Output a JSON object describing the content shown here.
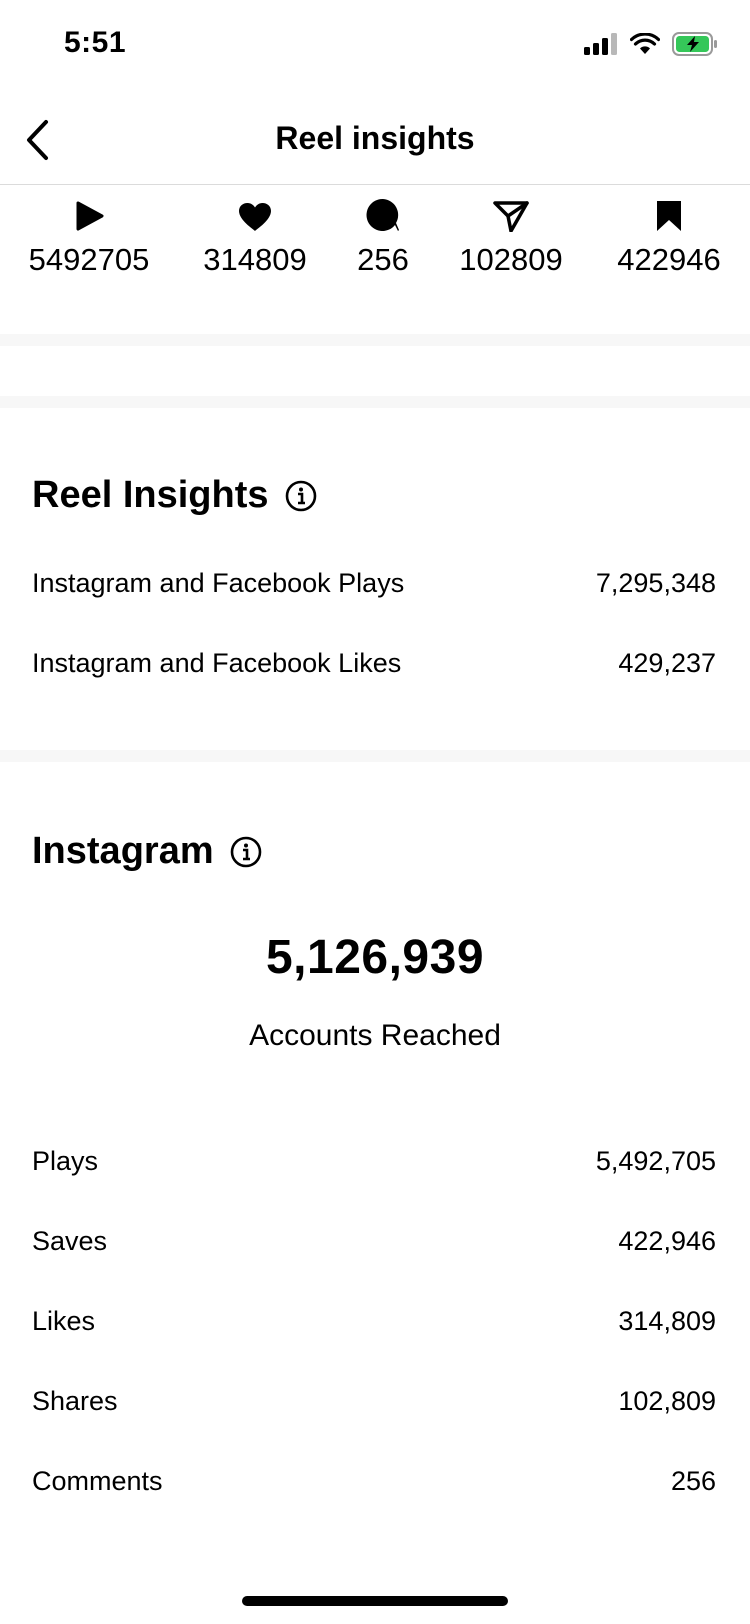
{
  "status": {
    "time": "5:51"
  },
  "header": {
    "title": "Reel insights"
  },
  "summary": {
    "plays": "5492705",
    "likes": "314809",
    "comments": "256",
    "shares": "102809",
    "saves": "422946"
  },
  "reel_insights": {
    "title": "Reel Insights",
    "rows": [
      {
        "label": "Instagram and Facebook Plays",
        "value": "7,295,348"
      },
      {
        "label": "Instagram and Facebook Likes",
        "value": "429,237"
      }
    ]
  },
  "instagram": {
    "title": "Instagram",
    "accounts_reached_value": "5,126,939",
    "accounts_reached_label": "Accounts Reached",
    "rows": [
      {
        "label": "Plays",
        "value": "5,492,705"
      },
      {
        "label": "Saves",
        "value": "422,946"
      },
      {
        "label": "Likes",
        "value": "314,809"
      },
      {
        "label": "Shares",
        "value": "102,809"
      },
      {
        "label": "Comments",
        "value": "256"
      }
    ]
  },
  "icons": {
    "back": "chevron-left-icon",
    "plays": "play-icon",
    "likes": "heart-icon",
    "comments": "comment-icon",
    "shares": "send-icon",
    "saves": "bookmark-icon",
    "info": "info-icon"
  },
  "colors": {
    "battery_fill": "#35c759"
  }
}
